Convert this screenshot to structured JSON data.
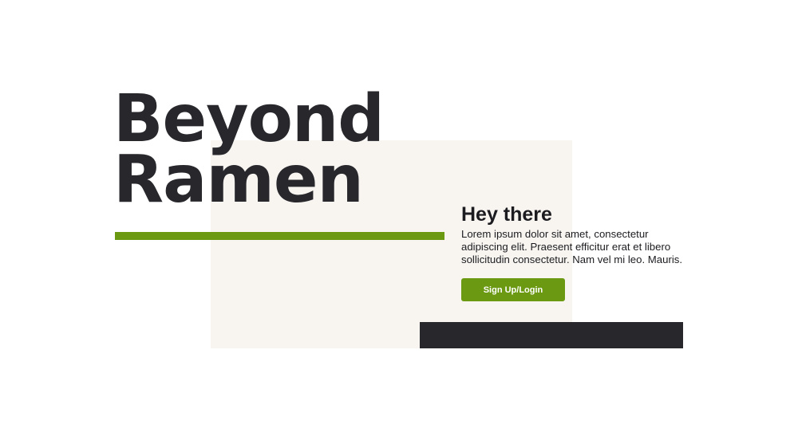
{
  "hero": {
    "title_line1": "Beyond",
    "title_line2": "Ramen"
  },
  "card": {
    "heading": "Hey there",
    "body": "Lorem ipsum dolor sit amet, consectetur adipiscing elit. Praesent efficitur erat et libero sollicitudin consectetur. Nam vel mi leo. Mauris.",
    "button_label": "Sign Up/Login"
  },
  "colors": {
    "accent_green": "#6b9a12",
    "dark": "#27272c",
    "cream": "#f8f5f1",
    "background": "#ffffff"
  }
}
